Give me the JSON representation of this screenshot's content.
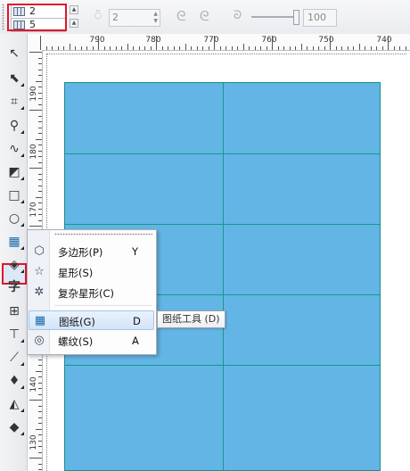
{
  "property_bar": {
    "columns_value": "2",
    "rows_value": "5",
    "sides_value": "2",
    "spiral_expansion_value": "100"
  },
  "rulers": {
    "horizontal_labels": [
      "790",
      "780",
      "770",
      "760",
      "750",
      "740"
    ],
    "vertical_labels": [
      "190",
      "180",
      "170",
      "160",
      "150",
      "140",
      "130"
    ]
  },
  "flyout_menu": {
    "items": [
      {
        "label": "多边形(P)",
        "shortcut": "Y",
        "icon": "polygon-icon"
      },
      {
        "label": "星形(S)",
        "shortcut": "",
        "icon": "star-icon"
      },
      {
        "label": "复杂星形(C)",
        "shortcut": "",
        "icon": "complex-star-icon"
      },
      {
        "label": "图纸(G)",
        "shortcut": "D",
        "icon": "graph-paper-icon"
      },
      {
        "label": "螺纹(S)",
        "shortcut": "A",
        "icon": "spiral-icon"
      }
    ]
  },
  "tooltip": "图纸工具 (D)",
  "toolbox": {
    "text_tool_glyph": "字"
  },
  "grid": {
    "columns": 2,
    "rows": 5,
    "fill_color": "#63b5e6",
    "line_color": "#139a8a"
  },
  "colors": {
    "highlight": "#e0152b"
  }
}
